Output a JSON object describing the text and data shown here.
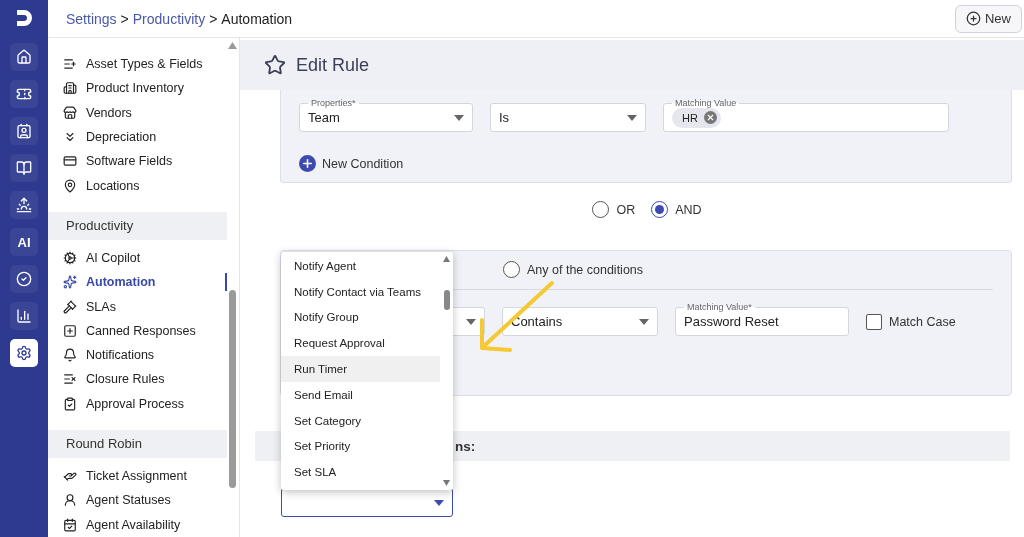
{
  "breadcrumb": [
    {
      "label": "Settings",
      "link": true
    },
    {
      "label": ">",
      "link": false
    },
    {
      "label": "Productivity",
      "link": true
    },
    {
      "label": ">",
      "link": false
    },
    {
      "label": "Automation",
      "link": false
    }
  ],
  "new_button": "New",
  "rail": [
    {
      "kind": "logo"
    },
    {
      "kind": "icon",
      "selected": false
    },
    {
      "kind": "icon",
      "selected": false
    },
    {
      "kind": "icon",
      "selected": false
    },
    {
      "kind": "icon",
      "selected": false
    },
    {
      "kind": "icon",
      "selected": false
    },
    {
      "kind": "text",
      "label": "AI",
      "selected": false
    },
    {
      "kind": "icon",
      "selected": false
    },
    {
      "kind": "icon",
      "selected": false
    },
    {
      "kind": "icon",
      "selected": true
    }
  ],
  "sidebar": {
    "groups": [
      {
        "items": [
          {
            "label": "Asset Types & Fields",
            "selected": false
          },
          {
            "label": "Product Inventory",
            "selected": false
          },
          {
            "label": "Vendors",
            "selected": false
          },
          {
            "label": "Depreciation",
            "selected": false
          },
          {
            "label": "Software Fields",
            "selected": false
          },
          {
            "label": "Locations",
            "selected": false
          }
        ]
      },
      {
        "heading": "Productivity",
        "items": [
          {
            "label": "AI Copilot",
            "selected": false
          },
          {
            "label": "Automation",
            "selected": true
          },
          {
            "label": "SLAs",
            "selected": false
          },
          {
            "label": "Canned Responses",
            "selected": false
          },
          {
            "label": "Notifications",
            "selected": false
          },
          {
            "label": "Closure Rules",
            "selected": false
          },
          {
            "label": "Approval Process",
            "selected": false
          }
        ]
      },
      {
        "heading": "Round Robin",
        "items": [
          {
            "label": "Ticket Assignment",
            "selected": false
          },
          {
            "label": "Agent Statuses",
            "selected": false
          },
          {
            "label": "Agent Availability",
            "selected": false
          }
        ]
      }
    ]
  },
  "page_title": "Edit Rule",
  "condition_card": {
    "fields": [
      {
        "kind": "select",
        "label": "Properties*",
        "value": "Team"
      },
      {
        "kind": "select",
        "value": "Is"
      },
      {
        "kind": "chips",
        "label": "Matching Value",
        "chips": [
          "HR"
        ]
      }
    ],
    "add_label": "New Condition"
  },
  "logic": [
    {
      "label": "OR",
      "selected": false
    },
    {
      "label": "AND",
      "selected": true
    }
  ],
  "event_card": {
    "match_option": {
      "label": "Any of the conditions",
      "selected": false
    },
    "fields": [
      {
        "kind": "select"
      },
      {
        "kind": "select",
        "value": "Contains"
      },
      {
        "kind": "text",
        "label": "Matching Value*",
        "value": "Password Reset"
      }
    ],
    "match_case": {
      "label": "Match Case",
      "checked": false
    }
  },
  "actions_heading": "ns:",
  "action_dropdown": {
    "options": [
      {
        "label": "Notify Agent",
        "selected": false
      },
      {
        "label": "Notify Contact via Teams",
        "selected": false
      },
      {
        "label": "Notify Group",
        "selected": false
      },
      {
        "label": "Request Approval",
        "selected": false
      },
      {
        "label": "Run Timer",
        "selected": true
      },
      {
        "label": "Send Email",
        "selected": false
      },
      {
        "label": "Set Category",
        "selected": false
      },
      {
        "label": "Set Priority",
        "selected": false
      },
      {
        "label": "Set SLA",
        "selected": false
      }
    ]
  }
}
